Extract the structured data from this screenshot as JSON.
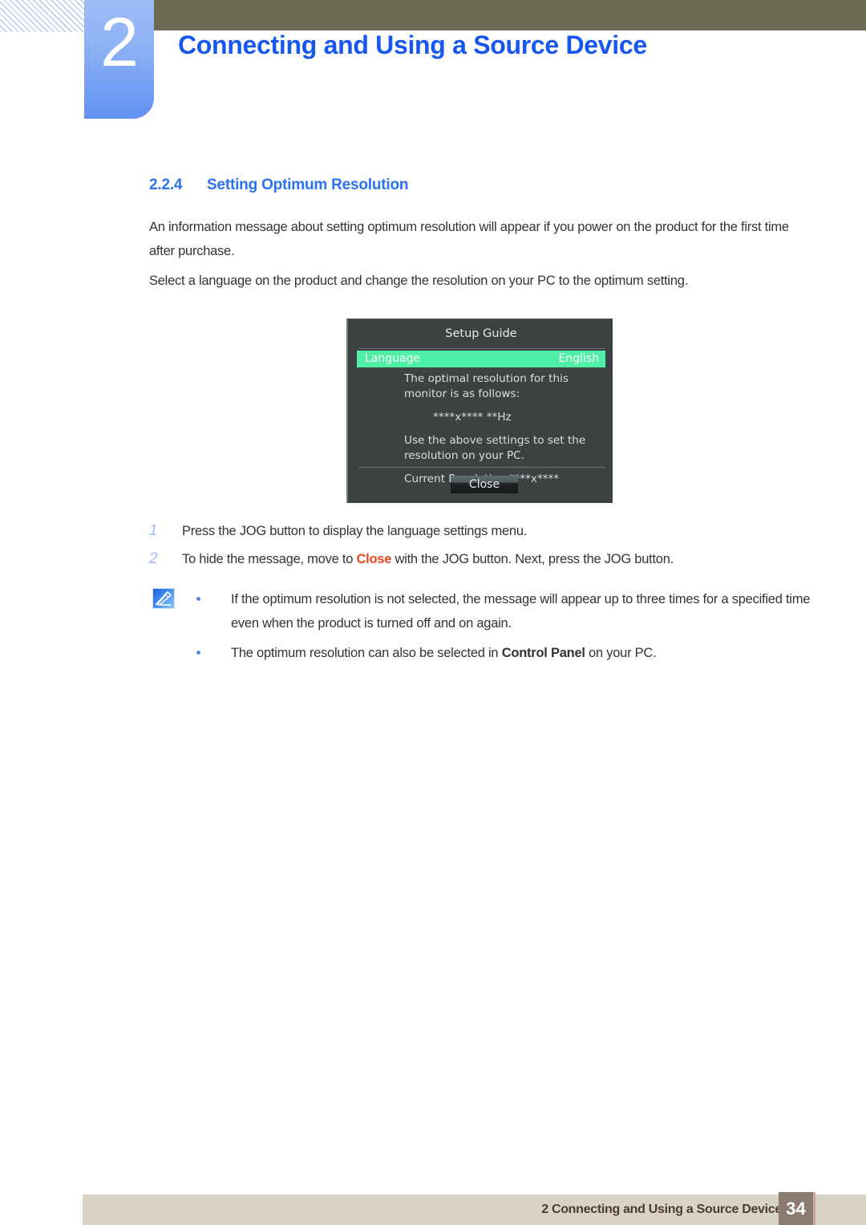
{
  "header": {
    "chapter_number": "2",
    "chapter_title": "Connecting and Using a Source Device"
  },
  "section": {
    "number": "2.2.4",
    "title": "Setting Optimum Resolution"
  },
  "paragraphs": {
    "p1": "An information message about setting optimum resolution will appear if you power on the product for the first time after purchase.",
    "p2": "Select a language on the product and change the resolution on your PC to the optimum setting."
  },
  "osd": {
    "title": "Setup Guide",
    "row_label": "Language",
    "row_value": "English",
    "line1": "The optimal resolution for this monitor is as follows:",
    "line2": "****x**** **Hz",
    "line3": "Use the above settings to set the resolution on your PC.",
    "line4": "Current Resolution ****x****",
    "close_label": "Close",
    "highlight_color": "#4ef0a8",
    "background_color": "#3c4142"
  },
  "steps": [
    {
      "number": "1",
      "text": "Press the JOG button to display the language settings menu."
    },
    {
      "number": "2",
      "text_before": "To hide the message, move to ",
      "highlight": "Close",
      "text_after": " with the JOG button. Next, press the JOG button.",
      "highlight_color": "#e8491a"
    }
  ],
  "notes": {
    "icon_name": "note-pen-icon",
    "items": [
      {
        "text_before": "If the optimum resolution is not selected, the message will appear up to three times for a specified time even when the product is turned off and on again.",
        "bold": "",
        "text_after": ""
      },
      {
        "text_before": "The optimum resolution can also be selected in ",
        "bold": "Control Panel",
        "text_after": " on your PC."
      }
    ]
  },
  "footer": {
    "text": "2 Connecting and Using a Source Device",
    "page_number": "34"
  }
}
